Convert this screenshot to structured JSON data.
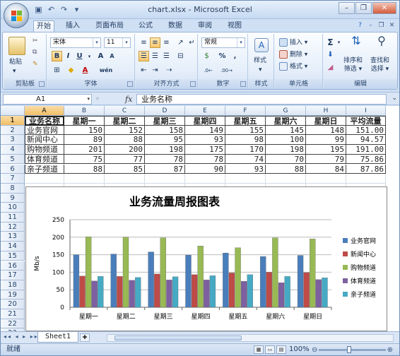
{
  "window": {
    "title": "chart.xlsx - Microsoft Excel"
  },
  "ribbon": {
    "tabs": [
      "开始",
      "插入",
      "页面布局",
      "公式",
      "数据",
      "审阅",
      "视图"
    ],
    "groups": {
      "clipboard": {
        "label": "剪贴板",
        "paste": "粘贴"
      },
      "font": {
        "label": "字体",
        "font_name": "宋体",
        "font_size": "11",
        "bold": "B",
        "italic": "I",
        "underline": "U",
        "grow": "A",
        "shrink": "A",
        "phonetic": "wén"
      },
      "alignment": {
        "label": "对齐方式"
      },
      "number": {
        "label": "数字",
        "format": "常规",
        "percent": "%",
        "comma": ","
      },
      "styles": {
        "label": "样式",
        "button": "样式"
      },
      "cells": {
        "label": "单元格",
        "insert": "插入",
        "delete": "删除",
        "format": "格式"
      },
      "editing": {
        "label": "编辑",
        "sort": "排序和\n筛选",
        "sort_l1": "排序和",
        "sort_l2": "筛选",
        "find_l1": "查找和",
        "find_l2": "选择"
      }
    }
  },
  "formula_bar": {
    "name_box": "A1",
    "fx": "fx",
    "value": "业务名称"
  },
  "sheet": {
    "columns": [
      "A",
      "B",
      "C",
      "D",
      "E",
      "F",
      "G",
      "H",
      "I"
    ],
    "rows": [
      "1",
      "2",
      "3",
      "4",
      "5",
      "6",
      "7",
      "8",
      "9",
      "10",
      "11",
      "12",
      "13",
      "14",
      "15",
      "16",
      "17",
      "18",
      "19",
      "20",
      "21",
      "22",
      "23"
    ],
    "header": [
      "业务名称",
      "星期一",
      "星期二",
      "星期三",
      "星期四",
      "星期五",
      "星期六",
      "星期日",
      "平均流量"
    ],
    "data": [
      [
        "业务官网",
        "150",
        "152",
        "158",
        "149",
        "155",
        "145",
        "148",
        "151.00"
      ],
      [
        "新闻中心",
        "89",
        "88",
        "95",
        "93",
        "98",
        "100",
        "99",
        "94.57"
      ],
      [
        "购物频道",
        "201",
        "200",
        "198",
        "175",
        "170",
        "198",
        "195",
        "191.00"
      ],
      [
        "体育频道",
        "75",
        "77",
        "78",
        "78",
        "74",
        "70",
        "79",
        "75.86"
      ],
      [
        "亲子频道",
        "88",
        "85",
        "87",
        "90",
        "93",
        "88",
        "84",
        "87.86"
      ]
    ]
  },
  "chart_data": {
    "type": "bar",
    "title": "业务流量周报图表",
    "ylabel": "Mb/s",
    "xlabel": "",
    "ylim": [
      0,
      250
    ],
    "yticks": [
      "0",
      "50",
      "100",
      "150",
      "200",
      "250"
    ],
    "categories": [
      "星期一",
      "星期二",
      "星期三",
      "星期四",
      "星期五",
      "星期六",
      "星期日"
    ],
    "series": [
      {
        "name": "业务官网",
        "color": "#4a7ebb",
        "values": [
          150,
          152,
          158,
          149,
          155,
          145,
          148
        ]
      },
      {
        "name": "新闻中心",
        "color": "#be4b48",
        "values": [
          89,
          88,
          95,
          93,
          98,
          100,
          99
        ]
      },
      {
        "name": "购物频道",
        "color": "#98b954",
        "values": [
          201,
          200,
          198,
          175,
          170,
          198,
          195
        ]
      },
      {
        "name": "体育频道",
        "color": "#7d60a0",
        "values": [
          75,
          77,
          78,
          78,
          74,
          70,
          79
        ]
      },
      {
        "name": "亲子频道",
        "color": "#46aac5",
        "values": [
          88,
          85,
          87,
          90,
          93,
          88,
          84
        ]
      }
    ],
    "grid": true,
    "legend": "right"
  },
  "sheet_tabs": {
    "active": "Sheet1"
  },
  "status": {
    "ready": "就绪",
    "zoom": "100%"
  }
}
